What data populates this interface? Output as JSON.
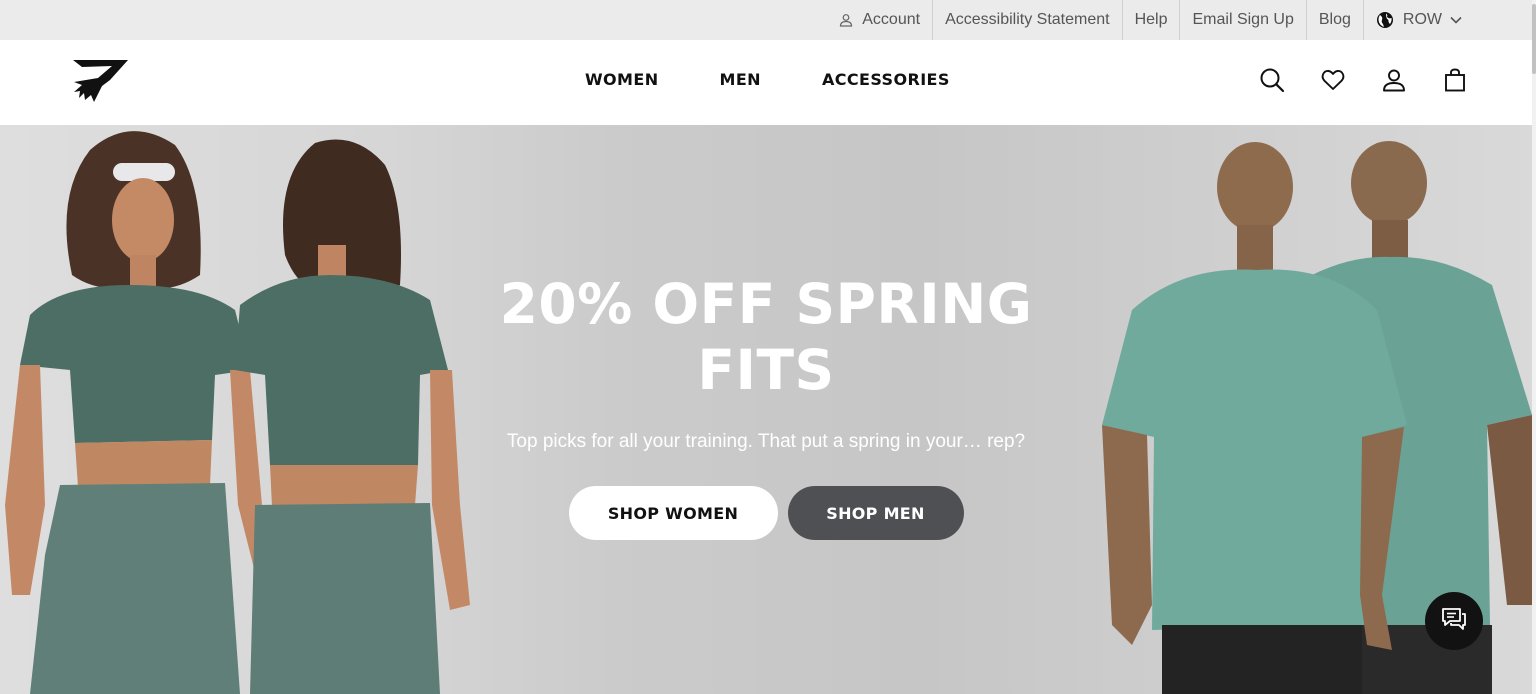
{
  "utility": {
    "account": "Account",
    "accessibility": "Accessibility Statement",
    "help": "Help",
    "email_signup": "Email Sign Up",
    "blog": "Blog",
    "region": "ROW"
  },
  "nav": {
    "women": "WOMEN",
    "men": "MEN",
    "accessories": "ACCESSORIES"
  },
  "icons": {
    "logo": "gymshark-shark-logo",
    "search": "search-icon",
    "wishlist": "heart-icon",
    "account": "user-icon",
    "bag": "shopping-bag-icon",
    "chat": "chat-icon",
    "region": "globe-icon"
  },
  "hero": {
    "title_line1": "20% OFF SPRING",
    "title_line2": "FITS",
    "subtitle": "Top picks for all your training. That put a spring in your… rep?",
    "shop_women": "SHOP WOMEN",
    "shop_men": "SHOP MEN"
  },
  "colors": {
    "utility_bg": "#ebebeb",
    "hero_bg": "#c8c8c8",
    "women_apparel": "#4d6e64",
    "men_apparel": "#6fa79b",
    "cta_dark": "#4f5054",
    "chat_bg": "#121212"
  }
}
